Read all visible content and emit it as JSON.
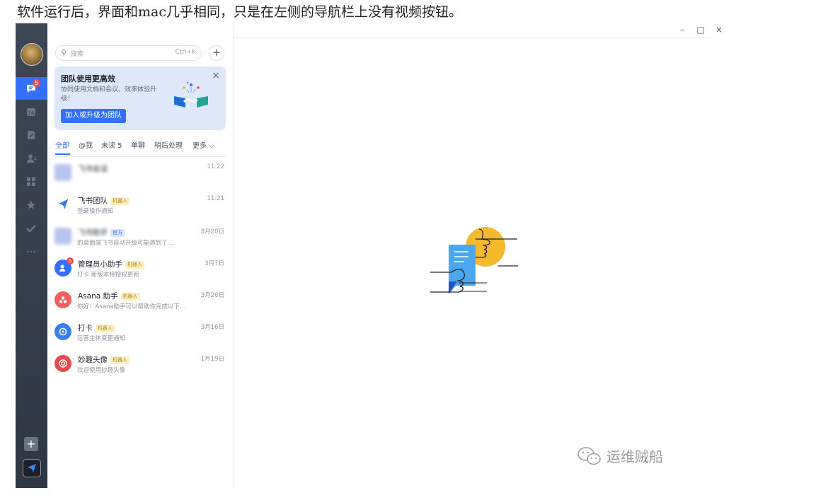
{
  "caption": "软件运行后，界面和mac几乎相同，只是在左侧的导航栏上没有视频按钮。",
  "window_controls": {
    "minimize": "–",
    "maximize": "□",
    "close": "×"
  },
  "rail": {
    "chat_badge": "5",
    "icons": [
      "chat-icon",
      "calendar-icon",
      "docs-icon",
      "contacts-icon",
      "workplace-icon",
      "favorites-icon",
      "tasks-icon",
      "more-icon"
    ],
    "plus": "+"
  },
  "search": {
    "placeholder": "搜索",
    "shortcut": "Ctrl+K"
  },
  "new_button": "+",
  "promo": {
    "title": "团队使用更高效",
    "desc": "协同使用文档和会议，效率体验升级！",
    "button": "加入或升级为团队",
    "close": "×"
  },
  "tabs": [
    {
      "label": "全部"
    },
    {
      "label": "@我"
    },
    {
      "label": "未读 5"
    },
    {
      "label": "单聊"
    },
    {
      "label": "稍后处理"
    },
    {
      "label": "更多 ⌵"
    }
  ],
  "chats": [
    {
      "name": "飞书会话",
      "tag": "",
      "preview": "",
      "time": "11:22",
      "blurred": true,
      "color": "#b8c4f0"
    },
    {
      "name": "飞书团队",
      "tag": "机器人",
      "tag_type": "robot",
      "preview": "登录操作通知",
      "time": "11:21",
      "color": "#ffffff"
    },
    {
      "name": "飞书助手",
      "tag": "官方",
      "tag_type": "official",
      "preview": "的桌面端飞书自动升级可能遇到了...",
      "time": "8月20日",
      "blurred_name": true,
      "color": "#b8c4f0"
    },
    {
      "name": "管理员小助手",
      "tag": "机器人",
      "tag_type": "robot",
      "preview": "打卡 新版本特授权更新",
      "time": "3月7日",
      "color": "#3370ff",
      "badge": "5"
    },
    {
      "name": "Asana 助手",
      "tag": "机器人",
      "tag_type": "robot",
      "preview": "你好！Asana助手可以帮助你完成以下操作: •...",
      "time": "3月26日",
      "color": "#f0605d"
    },
    {
      "name": "打卡",
      "tag": "机器人",
      "tag_type": "robot",
      "preview": "运营主体变更通知",
      "time": "3月16日",
      "color": "#3a7ef0"
    },
    {
      "name": "妙趣头像",
      "tag": "机器人",
      "tag_type": "robot",
      "preview": "欢迎使用妙趣头像",
      "time": "1月19日",
      "color": "#e8494f"
    }
  ],
  "watermark": "运维贼船"
}
